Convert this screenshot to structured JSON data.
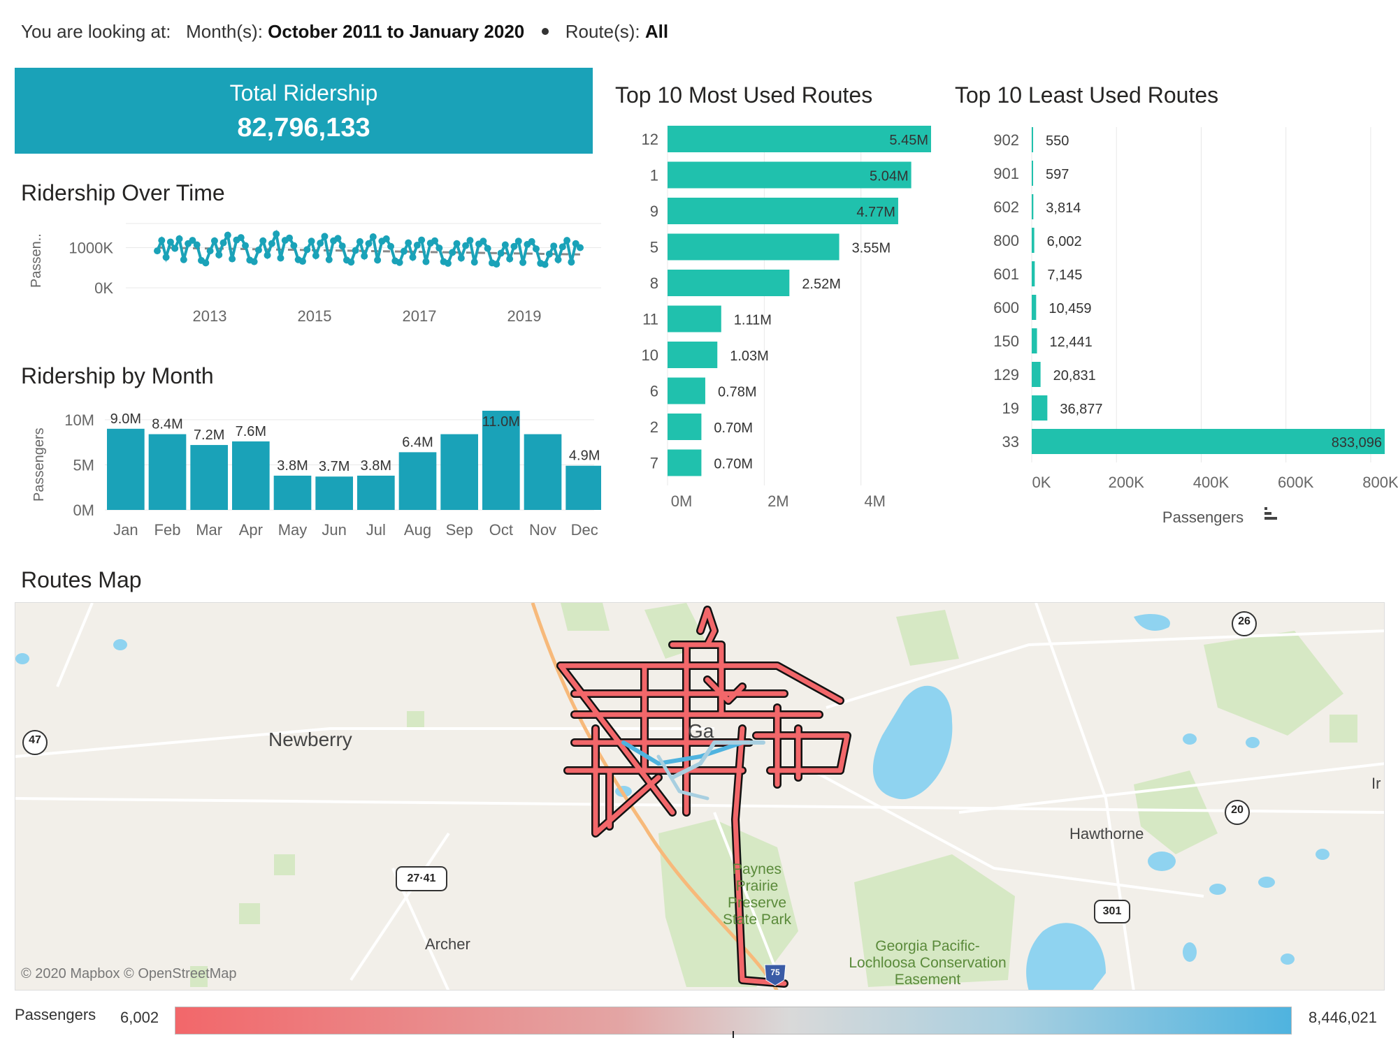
{
  "filter": {
    "prefix": "You are looking at:",
    "month_label": "Month(s):",
    "month_value": "October 2011 to January 2020",
    "route_label": "Route(s):",
    "route_value": "All"
  },
  "kpi": {
    "label": "Total Ridership",
    "value": "82,796,133"
  },
  "titles": {
    "over_time": "Ridership Over Time",
    "by_month": "Ridership by Month",
    "most_used": "Top 10 Most Used Routes",
    "least_used": "Top 10 Least Used Routes",
    "map": "Routes Map"
  },
  "chart_data": [
    {
      "id": "over_time",
      "type": "line",
      "title": "Ridership Over Time",
      "ylabel": "Passen..",
      "yticks": [
        "1000K",
        "0K"
      ],
      "xticks": [
        "2013",
        "2015",
        "2017",
        "2019"
      ],
      "ylim": [
        0,
        1600000
      ],
      "x_range": [
        "2011-10",
        "2020-01"
      ],
      "trend_line": "dashed",
      "series": [
        {
          "values": [
            920000,
            1180000,
            760000,
            1140000,
            980000,
            1220000,
            700000,
            1100000,
            1180000,
            1070000,
            680000,
            620000,
            920000,
            1170000,
            820000,
            1120000,
            1310000,
            720000,
            1190000,
            1250000,
            1050000,
            690000,
            650000,
            940000,
            1170000,
            810000,
            1100000,
            1340000,
            740000,
            1180000,
            1240000,
            1050000,
            700000,
            660000,
            950000,
            1160000,
            800000,
            1110000,
            1280000,
            700000,
            1170000,
            1230000,
            1040000,
            690000,
            640000,
            930000,
            1150000,
            790000,
            1100000,
            1270000,
            690000,
            1160000,
            1220000,
            1030000,
            670000,
            630000,
            910000,
            1120000,
            760000,
            1060000,
            1190000,
            650000,
            1110000,
            1170000,
            990000,
            650000,
            610000,
            880000,
            1100000,
            740000,
            1050000,
            1180000,
            640000,
            1090000,
            1160000,
            980000,
            620000,
            590000,
            860000,
            1070000,
            720000,
            1030000,
            1160000,
            630000,
            1080000,
            1150000,
            970000,
            610000,
            580000,
            840000,
            1040000,
            700000,
            1020000,
            1180000,
            640000,
            1100000,
            1000000
          ]
        }
      ]
    },
    {
      "id": "by_month",
      "type": "bar",
      "title": "Ridership by Month",
      "ylabel": "Passengers",
      "yticks": [
        "10M",
        "5M",
        "0M"
      ],
      "ylim": [
        0,
        11000000
      ],
      "categories": [
        "Jan",
        "Feb",
        "Mar",
        "Apr",
        "May",
        "Jun",
        "Jul",
        "Aug",
        "Sep",
        "Oct",
        "Nov",
        "Dec"
      ],
      "values": [
        9.0,
        8.4,
        7.2,
        7.6,
        3.8,
        3.7,
        3.8,
        6.4,
        8.4,
        11.0,
        8.4,
        4.9
      ],
      "labels": [
        "9.0M",
        "8.4M",
        "7.2M",
        "7.6M",
        "3.8M",
        "3.7M",
        "3.8M",
        "6.4M",
        "",
        "11.0M",
        "",
        "4.9M"
      ]
    },
    {
      "id": "most_used",
      "type": "bar",
      "title": "Top 10 Most Used Routes",
      "orientation": "horizontal",
      "categories": [
        "12",
        "1",
        "9",
        "5",
        "8",
        "11",
        "10",
        "6",
        "2",
        "7"
      ],
      "values": [
        5.45,
        5.04,
        4.77,
        3.55,
        2.52,
        1.11,
        1.03,
        0.78,
        0.7,
        0.7
      ],
      "labels": [
        "5.45M",
        "5.04M",
        "4.77M",
        "3.55M",
        "2.52M",
        "1.11M",
        "1.03M",
        "0.78M",
        "0.70M",
        "0.70M"
      ],
      "xticks": [
        "0M",
        "2M",
        "4M"
      ],
      "xlim": [
        0,
        5.45
      ]
    },
    {
      "id": "least_used",
      "type": "bar",
      "title": "Top 10 Least Used Routes",
      "orientation": "horizontal",
      "categories": [
        "902",
        "901",
        "602",
        "800",
        "601",
        "600",
        "150",
        "129",
        "19",
        "33"
      ],
      "values": [
        550,
        597,
        3814,
        6002,
        7145,
        10459,
        12441,
        20831,
        36877,
        833096
      ],
      "labels": [
        "550",
        "597",
        "3,814",
        "6,002",
        "7,145",
        "10,459",
        "12,441",
        "20,831",
        "36,877",
        "833,096"
      ],
      "xticks": [
        "0K",
        "200K",
        "400K",
        "600K",
        "800K"
      ],
      "xlabel": "Passengers",
      "xlim": [
        0,
        833096
      ]
    }
  ],
  "map": {
    "attribution": "© 2020 Mapbox © OpenStreetMap",
    "places": {
      "newberry": "Newberry",
      "city": "Ga",
      "hawthorne": "Hawthorne",
      "archer": "Archer",
      "paynes": "Paynes Prairie",
      "paynes2": "Preserve",
      "paynes3": "State Park",
      "georgia": "Georgia Pacific-",
      "georgia2": "Lochloosa Conservation",
      "georgia3": "Easement",
      "edge": "Ir"
    },
    "shields": {
      "s47": "47",
      "s26": "26",
      "s20": "20",
      "s2741": "27·41",
      "s301": "301",
      "s75": "75"
    },
    "colors": {
      "land": "#f2efe9",
      "water": "#8fd3f0",
      "park": "#d6e8c4",
      "road": "#ffffff",
      "route_hot": "#f2676a",
      "route_cool": "#4fb3df"
    }
  },
  "legend": {
    "label": "Passengers",
    "min": "6,002",
    "max": "8,446,021"
  },
  "colors": {
    "teal_dark": "#1aa2b8",
    "teal_bar": "#20c1ad",
    "grid": "#e8e8e8"
  }
}
